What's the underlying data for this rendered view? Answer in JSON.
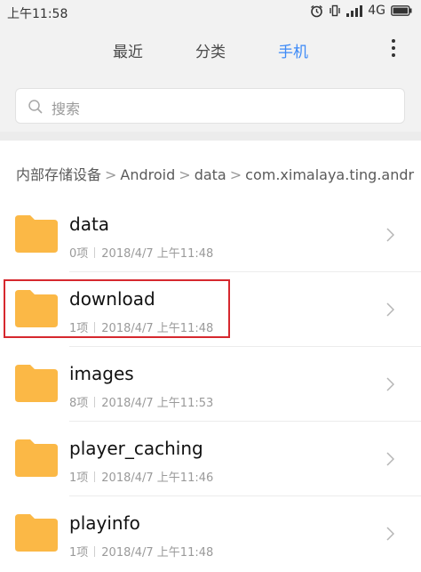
{
  "status_bar": {
    "time": "上午11:58",
    "network": "4G"
  },
  "tabs": [
    {
      "label": "最近",
      "active": false
    },
    {
      "label": "分类",
      "active": false
    },
    {
      "label": "手机",
      "active": true
    }
  ],
  "search": {
    "placeholder": "搜索"
  },
  "breadcrumb": [
    "内部存储设备",
    "Android",
    "data",
    "com.ximalaya.ting.andr"
  ],
  "folders": [
    {
      "name": "data",
      "count": "0项",
      "date": "2018/4/7 上午11:48"
    },
    {
      "name": "download",
      "count": "1项",
      "date": "2018/4/7 上午11:48",
      "highlighted": true
    },
    {
      "name": "images",
      "count": "8项",
      "date": "2018/4/7 上午11:53"
    },
    {
      "name": "player_caching",
      "count": "1项",
      "date": "2018/4/7 上午11:46"
    },
    {
      "name": "playinfo",
      "count": "1项",
      "date": "2018/4/7 上午11:48"
    }
  ],
  "colors": {
    "accent": "#3d8af7",
    "folder": "#fbb846",
    "highlight": "#d6282e"
  },
  "icons": [
    "alarm-icon",
    "vibrate-icon",
    "signal-icon",
    "battery-icon",
    "search-icon",
    "more-icon",
    "folder-icon",
    "chevron-right-icon"
  ]
}
